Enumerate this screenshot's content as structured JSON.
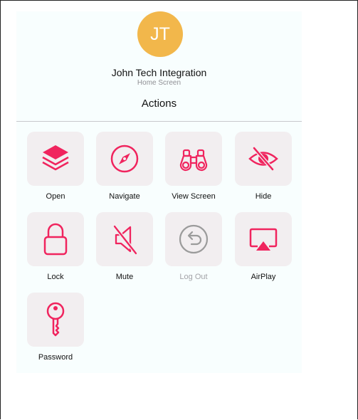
{
  "user": {
    "initials": "JT",
    "name": "John Tech Integration",
    "location": "Home Screen",
    "avatar_color": "#f2b74b"
  },
  "section_title": "Actions",
  "accent_color": "#f0245e",
  "disabled_color": "#9b9b9b",
  "actions": [
    {
      "label": "Open",
      "icon": "layers-icon",
      "enabled": true
    },
    {
      "label": "Navigate",
      "icon": "compass-icon",
      "enabled": true
    },
    {
      "label": "View Screen",
      "icon": "binoculars-icon",
      "enabled": true
    },
    {
      "label": "Hide",
      "icon": "eye-slash-icon",
      "enabled": true
    },
    {
      "label": "Lock",
      "icon": "lock-icon",
      "enabled": true
    },
    {
      "label": "Mute",
      "icon": "speaker-muted-icon",
      "enabled": true
    },
    {
      "label": "Log Out",
      "icon": "logout-arrow-icon",
      "enabled": false
    },
    {
      "label": "AirPlay",
      "icon": "airplay-icon",
      "enabled": true
    },
    {
      "label": "Password",
      "icon": "key-icon",
      "enabled": true
    }
  ]
}
